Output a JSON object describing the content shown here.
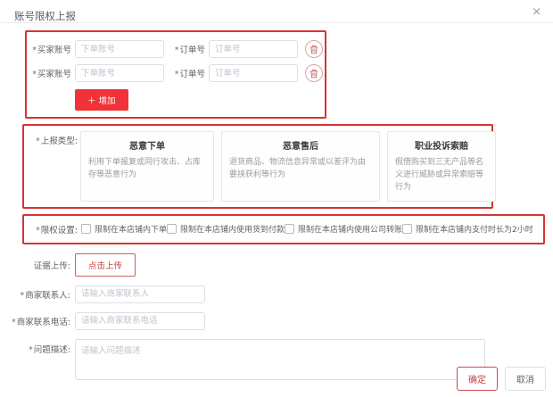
{
  "dialog": {
    "title": "账号限权上报",
    "close_glyph": "×"
  },
  "required_mark": "*",
  "buyer_row": {
    "account_label": "买家账号",
    "account_placeholder": "下单账号",
    "order_label": "订单号",
    "order_placeholder": "订单号",
    "add_button": "＋ 增加"
  },
  "report_type": {
    "label": "上报类型:",
    "cards": [
      {
        "title": "恶意下单",
        "desc": "利用下单报复或同行攻击、占库存等恶意行为"
      },
      {
        "title": "恶意售后",
        "desc": "退货商品、物流信息异常或以差评为由要挟获利等行为"
      },
      {
        "title": "职业投诉索赔",
        "desc": "假借购买到三无产品等名义进行威胁或异常索赔等行为"
      }
    ]
  },
  "restrictions": {
    "label": "限权设置:",
    "options": [
      "限制在本店铺内下单",
      "限制在本店铺内使用货到付款",
      "限制在本店铺内使用公司转账",
      "限制在本店铺内支付时长为2小时"
    ]
  },
  "evidence": {
    "label": "证据上传:",
    "upload_button": "点击上传"
  },
  "contact": {
    "label": "商家联系人:",
    "placeholder": "请输入商家联系人"
  },
  "phone": {
    "label": "商家联系电话:",
    "placeholder": "请输入商家联系电话"
  },
  "description": {
    "label": "问题描述:",
    "placeholder": "请输入问题描述"
  },
  "footer": {
    "confirm": "确定",
    "cancel": "取消"
  },
  "colors": {
    "annotation_border": "#d63333",
    "primary_button_bg": "#f03338",
    "outline_red": "#c94c4c",
    "input_border": "#dcdfe6",
    "label_text": "#606266",
    "placeholder_text": "#c0c4cc"
  }
}
